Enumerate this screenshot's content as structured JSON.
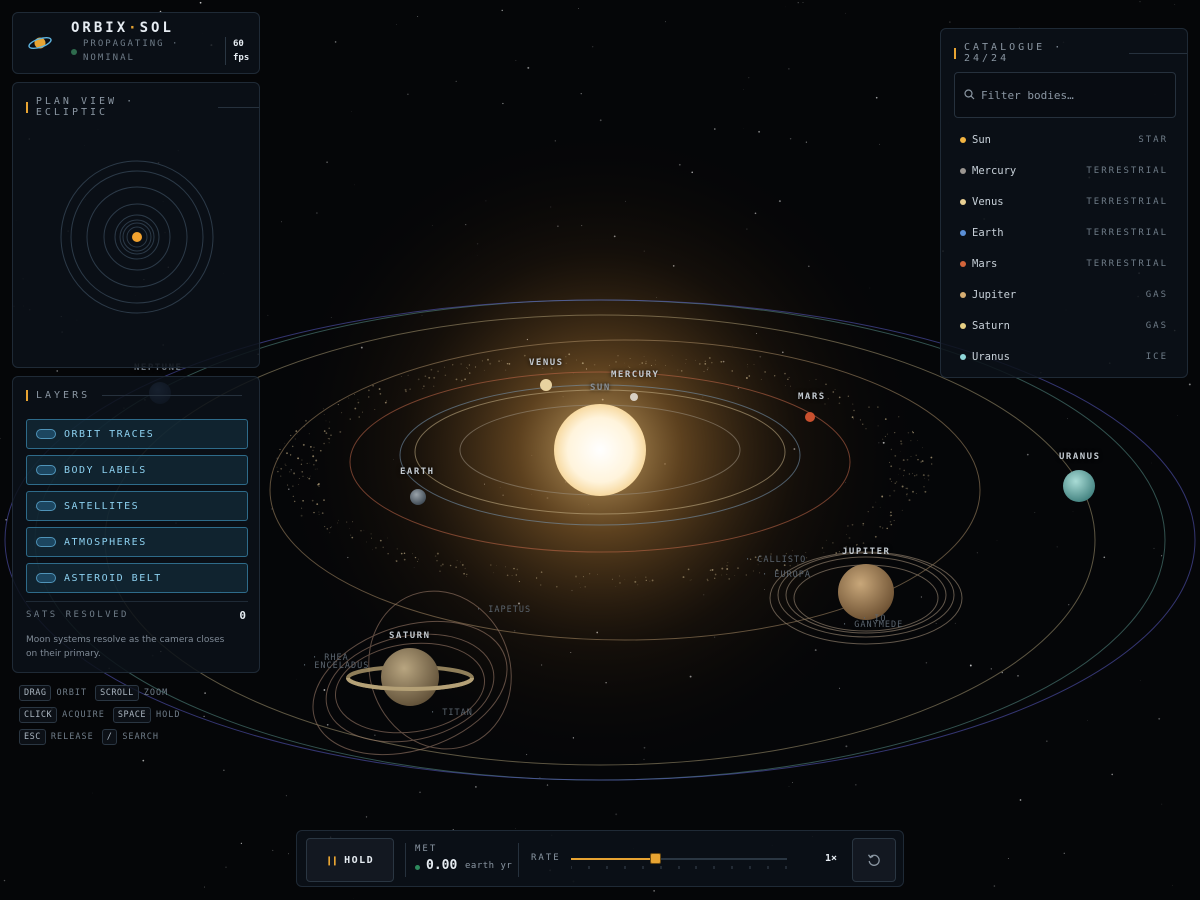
{
  "brand": {
    "name_a": "ORBIX",
    "name_sep": "·",
    "name_b": "SOL",
    "status_line1": "PROPAGATING ·",
    "status_line2": "NOMINAL",
    "fps_value": "60",
    "fps_unit": "fps"
  },
  "plan_view": {
    "title": "PLAN VIEW · ECLIPTIC"
  },
  "layers": {
    "title": "LAYERS",
    "toggles": [
      {
        "label": "ORBIT TRACES",
        "on": true
      },
      {
        "label": "BODY LABELS",
        "on": true
      },
      {
        "label": "SATELLITES",
        "on": true
      },
      {
        "label": "ATMOSPHERES",
        "on": true
      },
      {
        "label": "ASTEROID BELT",
        "on": true
      }
    ],
    "sats_label": "SATS RESOLVED",
    "sats_count": "0",
    "note": "Moon systems resolve as the camera closes on their primary."
  },
  "shortcuts": [
    [
      {
        "key": "DRAG",
        "desc": "ORBIT"
      },
      {
        "key": "SCROLL",
        "desc": "ZOOM"
      }
    ],
    [
      {
        "key": "CLICK",
        "desc": "ACQUIRE"
      },
      {
        "key": "SPACE",
        "desc": "HOLD"
      }
    ],
    [
      {
        "key": "ESC",
        "desc": "RELEASE"
      },
      {
        "key": "/",
        "desc": "SEARCH"
      }
    ]
  ],
  "catalogue": {
    "title": "CATALOGUE · 24/24",
    "filter_placeholder": "Filter bodies…",
    "items": [
      {
        "name": "Sun",
        "type": "STAR",
        "color": "#f2b441"
      },
      {
        "name": "Mercury",
        "type": "TERRESTRIAL",
        "color": "#9a9590"
      },
      {
        "name": "Venus",
        "type": "TERRESTRIAL",
        "color": "#e8cf93"
      },
      {
        "name": "Earth",
        "type": "TERRESTRIAL",
        "color": "#5b8fd6"
      },
      {
        "name": "Mars",
        "type": "TERRESTRIAL",
        "color": "#d2643a"
      },
      {
        "name": "Jupiter",
        "type": "GAS",
        "color": "#d6ad72"
      },
      {
        "name": "Saturn",
        "type": "GAS",
        "color": "#e6cf83"
      },
      {
        "name": "Uranus",
        "type": "ICE",
        "color": "#8fd6d9"
      }
    ]
  },
  "scene": {
    "planets": [
      "SUN",
      "MERCURY",
      "VENUS",
      "EARTH",
      "MARS",
      "JUPITER",
      "SATURN",
      "URANUS",
      "NEPTUNE"
    ],
    "moons": [
      "IAPETUS",
      "CALLISTO",
      "EUROPA",
      "IO",
      "GANYMEDE",
      "RHEA",
      "ENCELADUS",
      "TITAN"
    ]
  },
  "timebar": {
    "hold_label": "HOLD",
    "met_label": "MET",
    "met_value": "0.00",
    "met_unit": "earth yr",
    "rate_label": "RATE",
    "rate_value": "1×",
    "rate_position": 0.39
  },
  "colors": {
    "accent": "#e8a432",
    "toggle": "#8cd0ef"
  }
}
